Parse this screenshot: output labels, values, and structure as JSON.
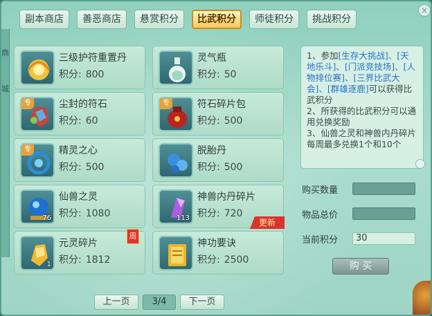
{
  "tabs": [
    "副本商店",
    "善恶商店",
    "悬赏积分",
    "比武积分",
    "师徒积分",
    "挑战积分"
  ],
  "active_tab": 3,
  "left_edge_text": [
    "商",
    "城"
  ],
  "close_label": "×",
  "points_label": "积分:",
  "items": [
    {
      "name": "三级护符重置丹",
      "points": "800",
      "icon": "gold-lotus-pill-icon",
      "badge": "",
      "count": "",
      "tag": ""
    },
    {
      "name": "灵气瓶",
      "points": "50",
      "icon": "spirit-bottle-icon",
      "badge": "",
      "count": "",
      "tag": ""
    },
    {
      "name": "尘封的符石",
      "points": "60",
      "icon": "sealed-rune-stone-icon",
      "badge": "专",
      "count": "",
      "tag": ""
    },
    {
      "name": "符石碎片包",
      "points": "500",
      "icon": "rune-fragment-bag-icon",
      "badge": "专",
      "count": "",
      "tag": ""
    },
    {
      "name": "精灵之心",
      "points": "500",
      "icon": "elf-heart-icon",
      "badge": "专",
      "count": "",
      "tag": ""
    },
    {
      "name": "脱胎丹",
      "points": "500",
      "icon": "rebirth-pill-icon",
      "badge": "",
      "count": "",
      "tag": ""
    },
    {
      "name": "仙兽之灵",
      "points": "1080",
      "icon": "beast-spirit-orb-icon",
      "badge": "",
      "count": "76",
      "tag": ""
    },
    {
      "name": "神兽内丹碎片",
      "points": "720",
      "icon": "crystal-shard-icon",
      "badge": "",
      "count": "113",
      "tag": "更新"
    },
    {
      "name": "元灵碎片",
      "points": "1812",
      "icon": "yuanling-fragment-icon",
      "badge": "",
      "count": "1",
      "tag": "周"
    },
    {
      "name": "神功要诀",
      "points": "2500",
      "icon": "golden-manual-icon",
      "badge": "",
      "count": "",
      "tag": ""
    }
  ],
  "pager": {
    "prev": "上一页",
    "page": "3/4",
    "next": "下一页"
  },
  "info": {
    "p1_a": "1、参加",
    "p1_b": "[生存大挑战]、[天地乐斗]、[门派竞技场]、[人物排位赛]、[三界比武大会]、[群雄逐鹿]",
    "p1_c": "可以获得比武积分",
    "p2": "2、所获得的比武积分可以通用兑换奖励",
    "p3": "3、仙兽之灵和神兽内丹碎片每周最多兑换1个和10个"
  },
  "form": {
    "qty_label": "购买数量",
    "qty_value": "",
    "total_label": "物品总价",
    "total_value": "",
    "current_label": "当前积分",
    "current_value": "30",
    "buy_label": "购 买"
  }
}
